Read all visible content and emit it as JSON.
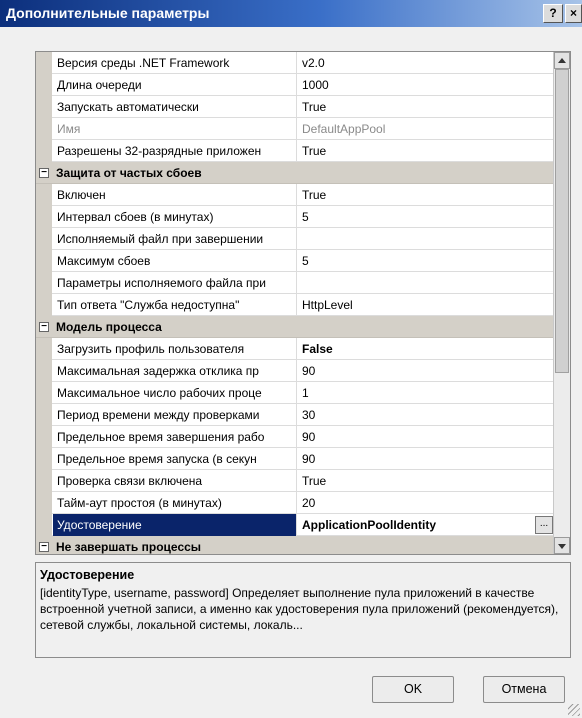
{
  "window": {
    "title": "Дополнительные параметры",
    "help_label": "?",
    "close_label": "×"
  },
  "grid": {
    "rows": [
      {
        "type": "property",
        "name": "Версия среды .NET Framework",
        "value": "v2.0"
      },
      {
        "type": "property",
        "name": "Длина очереди",
        "value": "1000"
      },
      {
        "type": "property",
        "name": "Запускать автоматически",
        "value": "True"
      },
      {
        "type": "property",
        "name": "Имя",
        "value": "DefaultAppPool",
        "dim": true
      },
      {
        "type": "property",
        "name": "Разрешены 32-разрядные приложен",
        "value": "True"
      },
      {
        "type": "category",
        "name": "Защита от частых сбоев",
        "expander": "−"
      },
      {
        "type": "property",
        "name": "Включен",
        "value": "True"
      },
      {
        "type": "property",
        "name": "Интервал сбоев (в минутах)",
        "value": "5"
      },
      {
        "type": "property",
        "name": "Исполняемый файл при завершении",
        "value": ""
      },
      {
        "type": "property",
        "name": "Максимум сбоев",
        "value": "5"
      },
      {
        "type": "property",
        "name": "Параметры исполняемого файла при",
        "value": ""
      },
      {
        "type": "property",
        "name": "Тип ответа \"Служба недоступна\"",
        "value": "HttpLevel"
      },
      {
        "type": "category",
        "name": "Модель процесса",
        "expander": "−"
      },
      {
        "type": "property",
        "name": "Загрузить профиль пользователя",
        "value": "False",
        "bold": true
      },
      {
        "type": "property",
        "name": "Максимальная задержка отклика пр",
        "value": "90"
      },
      {
        "type": "property",
        "name": "Максимальное число рабочих проце",
        "value": "1"
      },
      {
        "type": "property",
        "name": "Период времени между проверками",
        "value": "30"
      },
      {
        "type": "property",
        "name": "Предельное время завершения рабо",
        "value": "90"
      },
      {
        "type": "property",
        "name": "Предельное время запуска (в секун",
        "value": "90"
      },
      {
        "type": "property",
        "name": "Проверка связи включена",
        "value": "True"
      },
      {
        "type": "property",
        "name": "Тайм-аут простоя (в минутах)",
        "value": "20"
      },
      {
        "type": "property",
        "name": "Удостоверение",
        "value": "ApplicationPoolIdentity",
        "selected": true,
        "ellipsis": "..."
      },
      {
        "type": "category",
        "name": "Не завершать процессы",
        "expander": "−"
      }
    ]
  },
  "description": {
    "title": "Удостоверение",
    "text": "[identityType, username, password] Определяет выполнение пула приложений в качестве встроенной учетной записи, а именно как удостоверения пула приложений (рекомендуется), сетевой службы, локальной системы, локаль..."
  },
  "buttons": {
    "ok": "OK",
    "cancel": "Отмена"
  }
}
